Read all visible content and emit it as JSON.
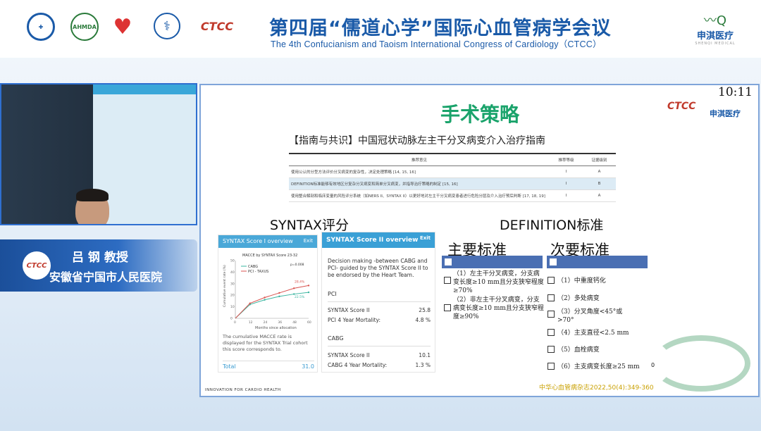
{
  "header": {
    "title_cn": "第四届“儒道心学”国际心血管病学会议",
    "title_en": "The 4th Confucianism and Taoism International Congress of Cardiology（CTCC）",
    "logo_ctcc": "CTCC",
    "logo_ahmda": "AHMDA",
    "sponsor_name": "申淇医疗",
    "sponsor_en": "SHENQI MEDICAL"
  },
  "speaker": {
    "name": "吕 钢 教授",
    "hospital": "安徽省宁国市人民医院",
    "nameplate": "吕 钢"
  },
  "slide": {
    "clock": "10:11",
    "title": "手术策略",
    "guide_title": "【指南与共识】中国冠状动脉左主干分叉病变介入治疗指南",
    "table_headers": [
      "推荐意见",
      "推荐等级",
      "证据级别"
    ],
    "table_rows": [
      {
        "text": "使用公认的分型方法评价分叉病变的复杂性，决定处理策略 [14, 15, 16]",
        "grade": "I",
        "level": "A"
      },
      {
        "text": "DEFINITION标准能够有效地区分复杂分叉病变和简单分叉病变，并指导治疗策略的制定 [15, 16]",
        "grade": "I",
        "level": "B"
      },
      {
        "text": "使用整合解剖和临床变量的风险评分系统（如NERS II、SYNTAX II）以更好地对左主干分叉病变患者进行危险分层及介入治疗预后判断 [17, 18, 19]",
        "grade": "I",
        "level": "A"
      }
    ],
    "syntax_heading": "SYNTAX评分",
    "definition_heading": "DEFINITION标准",
    "panel1": {
      "header": "SYNTAX Score I overview",
      "exit": "Exit",
      "chart_title": "MACCE by SYNTAX Score 23-32",
      "legend": [
        "CABG",
        "PCI - TAXUS"
      ],
      "p_value": "p=0.008",
      "label_high": "28.4%",
      "label_low": "22.5%",
      "xlabel": "Months since allocation",
      "ylabel": "Cumulative event rate (%)",
      "caption": "The cumulative MACCE rate is displayed for the SYNTAX Trial cohort this score corresponds to.",
      "total_label": "Total",
      "total_value": "31.0"
    },
    "panel2": {
      "header": "SYNTAX Score II overview",
      "exit": "Exit",
      "description": "Decision making -between CABG and PCI- guided by the SYNTAX Score II to be endorsed by the Heart Team.",
      "pci_label": "PCI",
      "pci_rows": [
        {
          "label": "SYNTAX Score II",
          "value": "25.8"
        },
        {
          "label": "PCI 4 Year Mortality:",
          "value": "4.8 %"
        }
      ],
      "cabg_label": "CABG",
      "cabg_rows": [
        {
          "label": "SYNTAX Score II",
          "value": "10.1"
        },
        {
          "label": "CABG 4 Year Mortality:",
          "value": "1.3 %"
        }
      ]
    },
    "major": {
      "heading": "主要标准",
      "items": [
        "（1）左主干分叉病变，分支病变长度≥10 mm且分支狭窄程度≥70%",
        "（2）非左主干分叉病变，分支病变长度≥10 mm且分支狭窄程度≥90%"
      ]
    },
    "minor": {
      "heading": "次要标准",
      "items": [
        "（1）中重度钙化",
        "（2）多处病变",
        "（3）分叉角度<45°或>70°",
        "（4）主支直径<2.5 mm",
        "（5）血栓病变",
        "（6）主支病变长度≥25 mm"
      ]
    },
    "zero_label": "0",
    "source": "中华心血管病杂志2022,50(4):349-360",
    "footer_brand": "INNOVATION FOR CARDIO HEALTH"
  },
  "chart_data": {
    "type": "line",
    "title": "MACCE by SYNTAX Score 23-32",
    "xlabel": "Months since allocation",
    "ylabel": "Cumulative event rate (%)",
    "x": [
      0,
      12,
      24,
      36,
      48,
      60
    ],
    "ylim": [
      0,
      50
    ],
    "xlim": [
      0,
      60
    ],
    "series": [
      {
        "name": "CABG",
        "values": [
          0,
          12,
          16,
          19,
          21,
          22.5
        ],
        "color": "#3ab5a0"
      },
      {
        "name": "PCI - TAXUS",
        "values": [
          0,
          13,
          18,
          22,
          26,
          28.4
        ],
        "color": "#d9534f"
      }
    ]
  }
}
